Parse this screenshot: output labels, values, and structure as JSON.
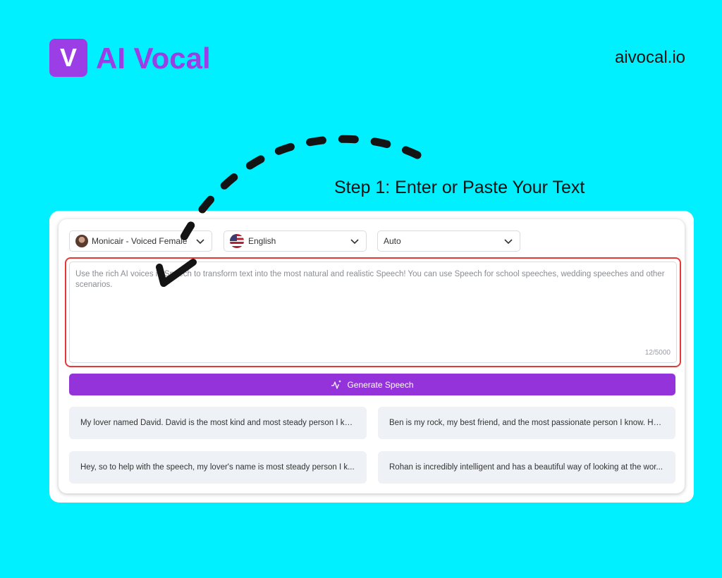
{
  "brand": {
    "logo_letter": "V",
    "name": "AI Vocal",
    "domain": "aivocal.io",
    "color": "#9b3ee6"
  },
  "step_title": "Step 1: Enter or Paste Your Text",
  "toolbar": {
    "voice": "Monicair - Voiced Female",
    "language": "English",
    "style": "Auto"
  },
  "editor": {
    "text": "Use the rich AI voices in Speech to transform text into the most natural and realistic Speech! You can use Speech for school speeches, wedding speeches and other scenarios.",
    "char_count": "12/5000"
  },
  "generate_button": "Generate Speech",
  "samples": [
    "My lover named David. David is the most kind and most steady person I kn...",
    "Ben is my rock, my best friend, and the most passionate person I know. He...",
    "Hey, so to help with the speech, my lover's name is most steady person I k...",
    "Rohan is incredibly intelligent and has a beautiful way of looking at the wor..."
  ],
  "colors": {
    "background": "#00f0ff",
    "accent": "#9333d9",
    "highlight_border": "#e53935"
  },
  "icons": {
    "voice": "avatar-icon",
    "language": "us-flag-icon",
    "dropdown": "chevron-down-icon",
    "generate": "sparkle-wave-icon",
    "annotation": "dashed-arrow-icon"
  }
}
